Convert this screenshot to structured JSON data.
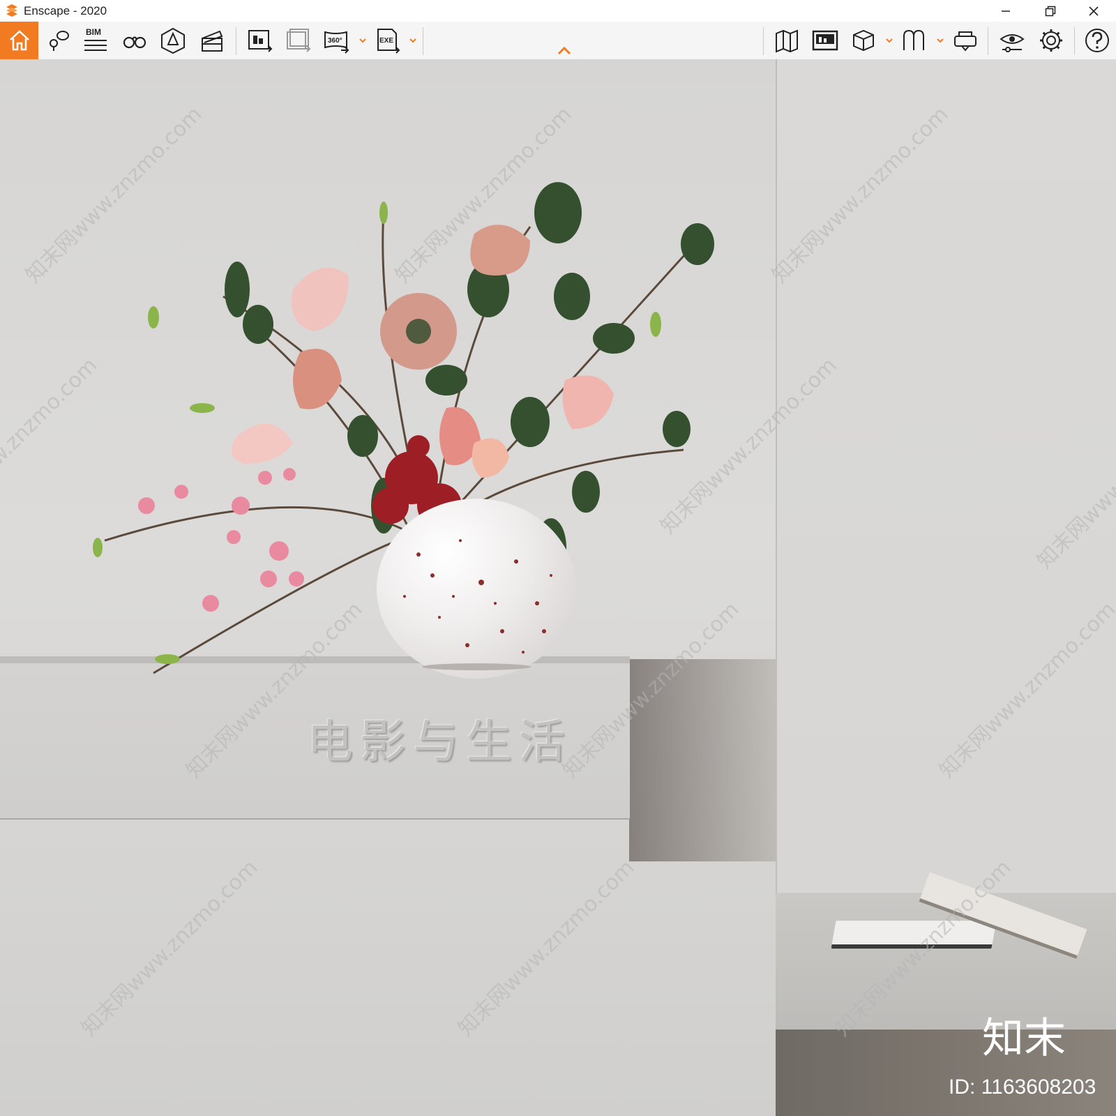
{
  "window": {
    "title": "Enscape - 2020"
  },
  "toolbar": {
    "bim_label": "BIM",
    "exe_label": "EXE",
    "pano_label": "360°",
    "accent_color": "#f27a21"
  },
  "viewport": {
    "shelf_text": "电影与生活",
    "watermark": "知末网www.znzmo.com",
    "brand": "知末",
    "image_id": "ID: 1163608203"
  },
  "icons": [
    "home-icon",
    "location-icon",
    "bim-icon",
    "binoculars-icon",
    "perspective-icon",
    "clapper-icon",
    "export-image-icon",
    "batch-export-icon",
    "panorama-export-icon",
    "exe-export-icon",
    "map-icon",
    "asset-library-icon",
    "cube-icon",
    "material-icon",
    "vr-headset-icon",
    "visual-settings-icon",
    "gear-icon",
    "help-icon",
    "minimize-icon",
    "restore-icon",
    "close-icon",
    "chevron-up-icon"
  ]
}
